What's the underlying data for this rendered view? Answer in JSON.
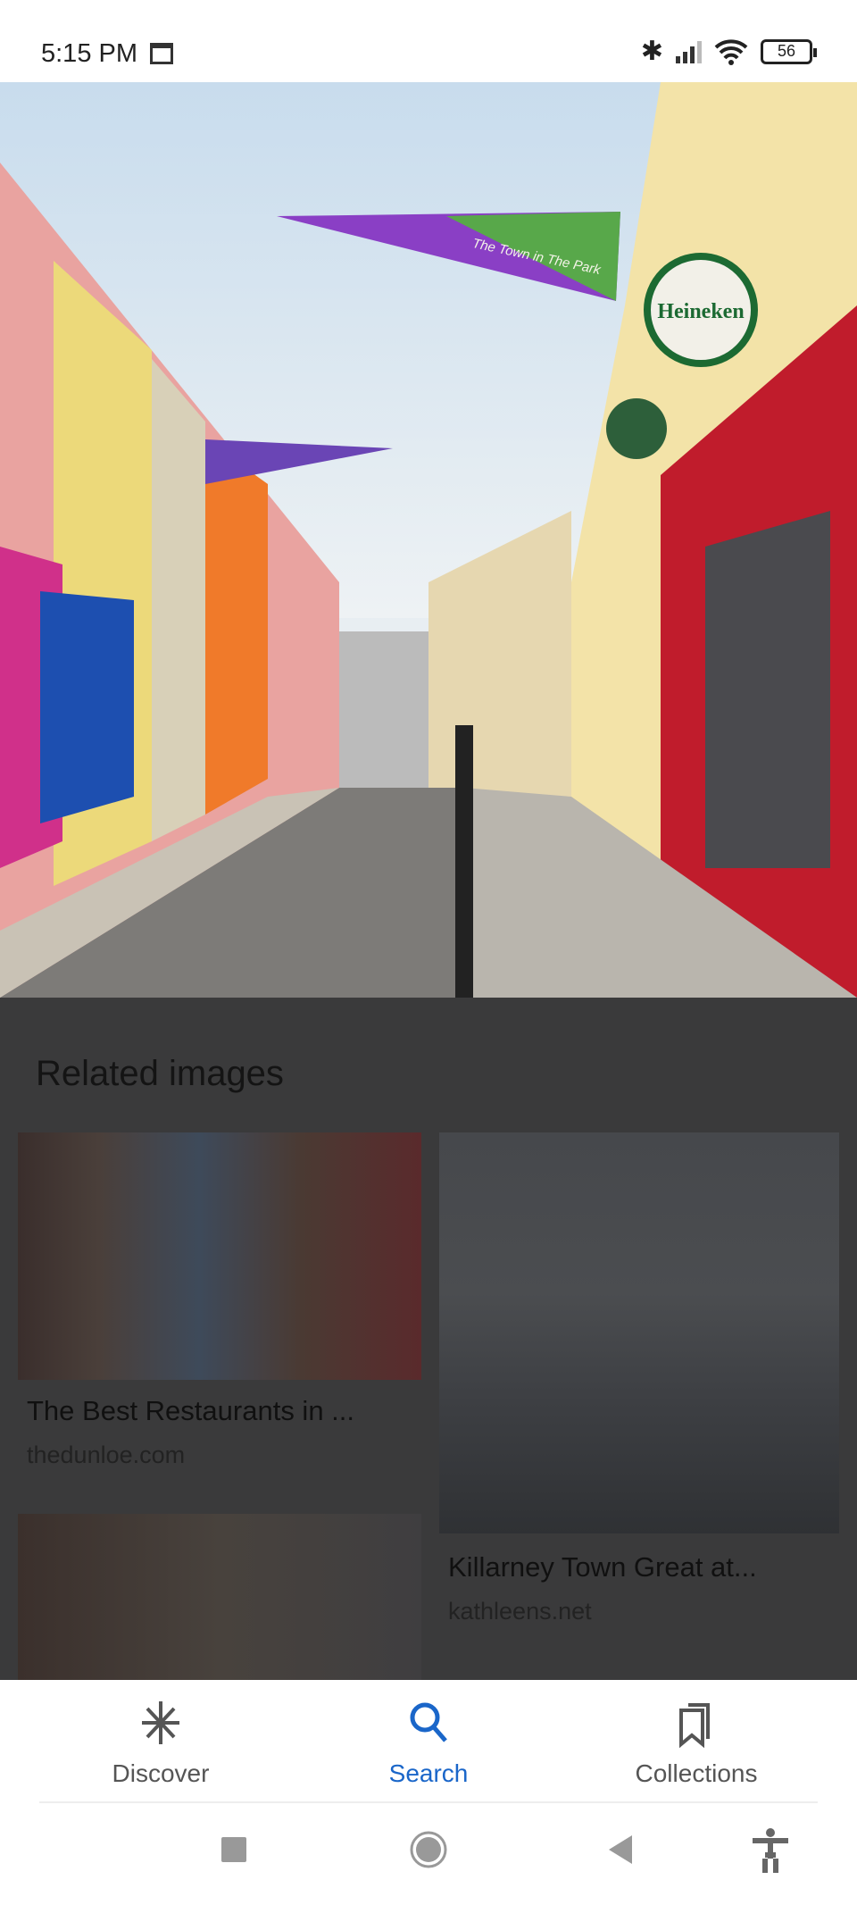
{
  "status_bar": {
    "time": "5:15 PM",
    "battery": "56"
  },
  "main_image": {
    "signs": [
      "Heineken",
      "The Town in The Park"
    ]
  },
  "related": {
    "heading": "Related images",
    "items": [
      {
        "title": "The Best Restaurants in ...",
        "source": "thedunloe.com"
      },
      {
        "title": "Killarney Town Great at...",
        "source": "kathleens.net"
      },
      {
        "title": "",
        "source": ""
      }
    ]
  },
  "bottom_nav": {
    "items": [
      {
        "label": "Discover",
        "icon": "asterisk-icon"
      },
      {
        "label": "Search",
        "icon": "search-icon",
        "active": true
      },
      {
        "label": "Collections",
        "icon": "bookmarks-icon"
      }
    ],
    "active_color": "#1a66c9"
  },
  "system_nav": [
    "recents",
    "home",
    "back",
    "accessibility"
  ]
}
